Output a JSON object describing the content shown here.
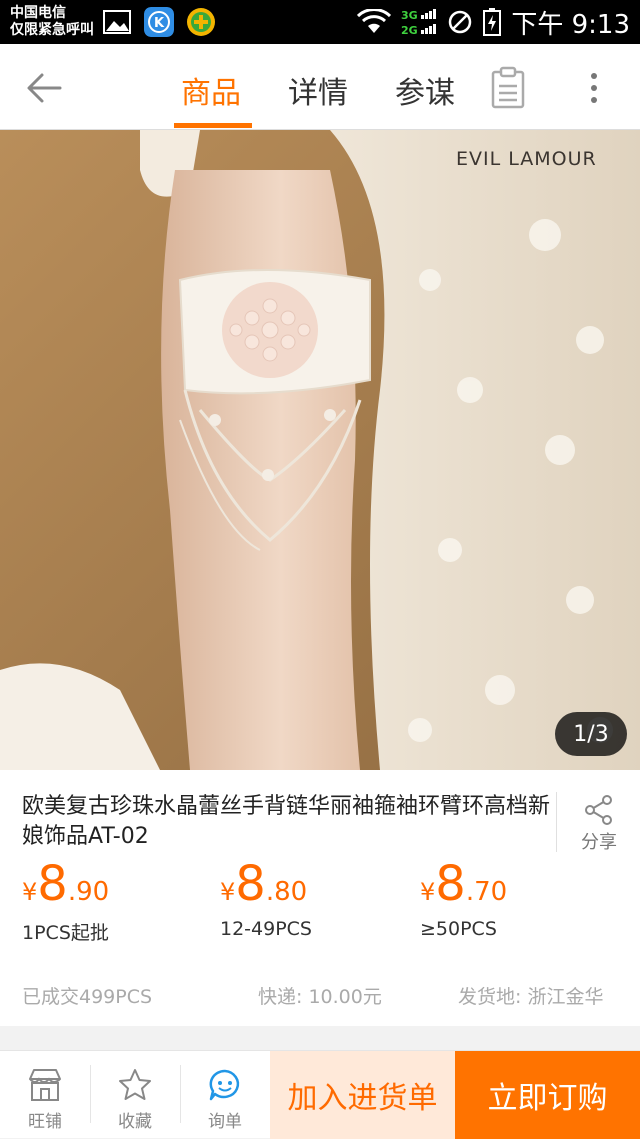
{
  "status_bar": {
    "carrier": "中国电信",
    "emergency": "仅限紧急呼叫",
    "network_top": "3G",
    "network_bottom": "2G",
    "time": "下午 9:13"
  },
  "nav": {
    "tabs": [
      {
        "label": "商品",
        "active": true
      },
      {
        "label": "详情",
        "active": false
      },
      {
        "label": "参谋",
        "active": false
      }
    ],
    "icons": [
      "back-arrow-icon",
      "clipboard-icon",
      "more-vertical-icon"
    ]
  },
  "gallery": {
    "brand_watermark": "EVIL LAMOUR",
    "counter": "1/3"
  },
  "product": {
    "title": "欧美复古珍珠水晶蕾丝手背链华丽袖箍袖环臂环高档新娘饰品AT-02",
    "share_label": "分享",
    "prices": [
      {
        "currency": "¥",
        "integer": "8",
        "decimal": ".90",
        "qty": "1PCS起批"
      },
      {
        "currency": "¥",
        "integer": "8",
        "decimal": ".80",
        "qty": "12-49PCS"
      },
      {
        "currency": "¥",
        "integer": "8",
        "decimal": ".70",
        "qty": "≥50PCS"
      }
    ],
    "sold": "已成交499PCS",
    "shipping": "快递: 10.00元",
    "origin": "发货地: 浙江金华"
  },
  "bottom_bar": {
    "shop_label": "旺铺",
    "favorite_label": "收藏",
    "inquiry_label": "询单",
    "add_cart_label": "加入进货单",
    "buy_now_label": "立即订购"
  },
  "colors": {
    "accent": "#ff7300",
    "price": "#ff6a00",
    "add_cart_bg": "#ffe9d9"
  }
}
